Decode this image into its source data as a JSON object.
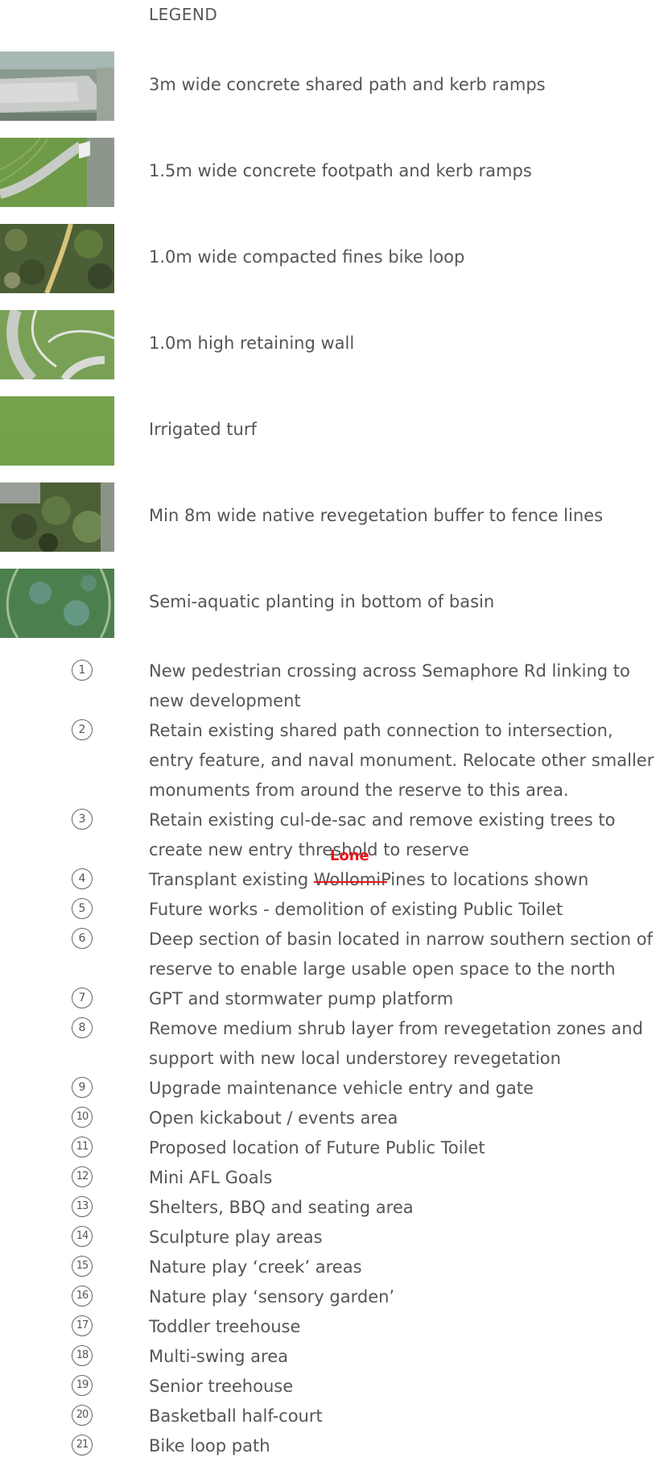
{
  "legend_title": "LEGEND",
  "swatches": [
    {
      "label": "3m wide concrete shared path and kerb ramps"
    },
    {
      "label": "1.5m wide concrete footpath and kerb ramps"
    },
    {
      "label": "1.0m wide compacted fines bike loop"
    },
    {
      "label": "1.0m high retaining wall"
    },
    {
      "label": "Irrigated turf"
    },
    {
      "label": "Min 8m wide native revegetation buffer to fence lines"
    },
    {
      "label": "Semi-aquatic planting in bottom of basin"
    }
  ],
  "notes": [
    {
      "number": "1",
      "text": "New pedestrian crossing across Semaphore Rd linking to new development"
    },
    {
      "number": "2",
      "text": "Retain existing shared path connection to intersection, entry feature, and naval monument. Relocate other smaller monuments from around the reserve to this area."
    },
    {
      "number": "3",
      "text": "Retain existing cul-de-sac and remove existing trees to create new entry threshold to reserve"
    },
    {
      "number": "4",
      "text_before": "Transplant existing ",
      "struck_word": "Wollomi",
      "inserted_word": "Lone",
      "text_after": "Pines to locations shown"
    },
    {
      "number": "5",
      "text": "Future works - demolition of existing Public Toilet"
    },
    {
      "number": "6",
      "text": "Deep section of basin located in narrow southern section of reserve to enable large usable open space to the north"
    },
    {
      "number": "7",
      "text": "GPT and stormwater pump platform"
    },
    {
      "number": "8",
      "text": "Remove medium shrub layer from revegetation zones and support with new local understorey revegetation"
    },
    {
      "number": "9",
      "text": "Upgrade maintenance vehicle entry and gate"
    },
    {
      "number": "10",
      "text": "Open kickabout / events area"
    },
    {
      "number": "11",
      "text": "Proposed location of Future Public Toilet"
    },
    {
      "number": "12",
      "text": "Mini AFL Goals"
    },
    {
      "number": "13",
      "text": "Shelters, BBQ and seating area"
    },
    {
      "number": "14",
      "text": "Sculpture play areas"
    },
    {
      "number": "15",
      "text": "Nature play ‘creek’ areas"
    },
    {
      "number": "16",
      "text": "Nature play ‘sensory garden’"
    },
    {
      "number": "17",
      "text": "Toddler treehouse"
    },
    {
      "number": "18",
      "text": "Multi-swing area"
    },
    {
      "number": "19",
      "text": "Senior treehouse"
    },
    {
      "number": "20",
      "text": "Basketball half-court"
    },
    {
      "number": "21",
      "text": "Bike loop path"
    }
  ],
  "colors": {
    "text": "#555555",
    "markup_red": "#e8161b"
  }
}
